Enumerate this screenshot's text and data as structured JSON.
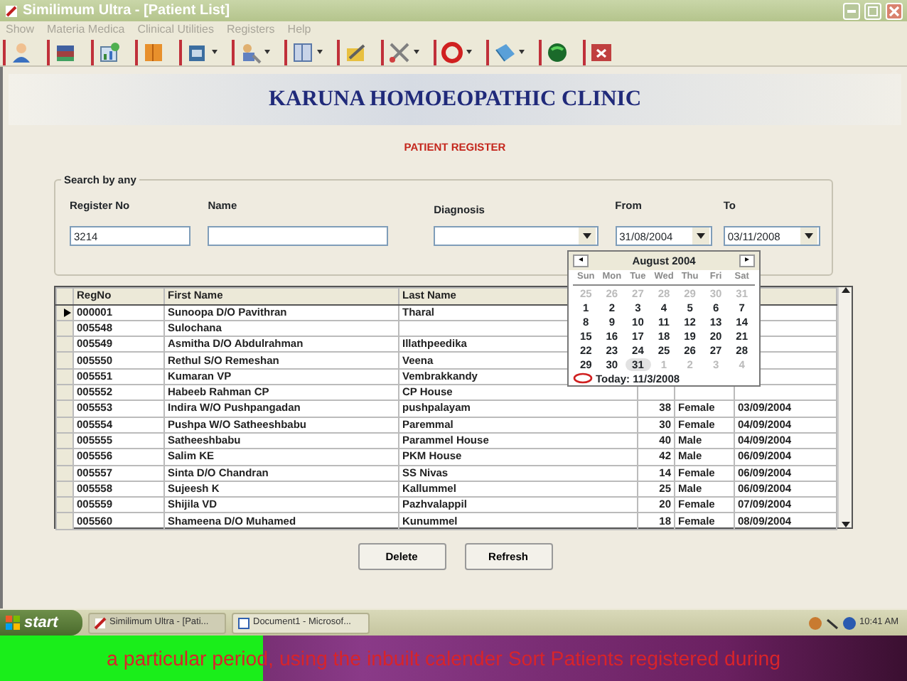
{
  "window": {
    "title": "Similimum Ultra - [Patient List]"
  },
  "menu": [
    "Show",
    "Materia Medica",
    "Clinical Utilities",
    "Registers",
    "Help"
  ],
  "toolbar": [
    {
      "kind": "person",
      "dropdown": false
    },
    {
      "kind": "books",
      "dropdown": false
    },
    {
      "kind": "chart",
      "dropdown": false
    },
    {
      "kind": "book",
      "dropdown": false
    },
    {
      "kind": "box",
      "dropdown": true
    },
    {
      "kind": "tools",
      "dropdown": true
    },
    {
      "kind": "notebook",
      "dropdown": true
    },
    {
      "kind": "pencil",
      "dropdown": false
    },
    {
      "kind": "scissors",
      "dropdown": true
    },
    {
      "kind": "ring",
      "dropdown": true
    },
    {
      "kind": "bookstack",
      "dropdown": true
    },
    {
      "kind": "globe",
      "dropdown": false
    },
    {
      "kind": "close",
      "dropdown": false
    }
  ],
  "clinic_name": "KARUNA HOMOEOPATHIC CLINIC",
  "page_title": "PATIENT REGISTER",
  "search": {
    "legend": "Search by any",
    "fields": [
      {
        "label": "Register No",
        "value": "3214",
        "kind": "text"
      },
      {
        "label": "Name",
        "kind": "text"
      },
      {
        "label": "Diagnosis",
        "kind": "combo"
      },
      {
        "label": "From",
        "value": "31/08/2004",
        "kind": "combo"
      },
      {
        "label": "To",
        "value": "03/11/2008",
        "kind": "combo"
      }
    ]
  },
  "table": {
    "columns": [
      "RegNo",
      "First Name",
      "Last Name"
    ],
    "rows": [
      {
        "selected": true,
        "cells": [
          "000001",
          "Sunoopa D/O Pavithran",
          "Tharal"
        ]
      },
      {
        "selected": false,
        "cells": [
          "005548",
          "Sulochana",
          ""
        ]
      },
      {
        "selected": false,
        "cells": [
          "005549",
          "Asmitha D/O Abdulrahman",
          "Illathpeedika"
        ]
      },
      {
        "selected": false,
        "cells": [
          "005550",
          "Rethul S/O Remeshan",
          "Veena"
        ]
      },
      {
        "selected": false,
        "cells": [
          "005551",
          "Kumaran VP",
          "Vembrakkandy"
        ]
      },
      {
        "selected": false,
        "cells": [
          "005552",
          "Habeeb Rahman CP",
          "CP House"
        ]
      },
      {
        "selected": false,
        "cells": [
          "005553",
          "Indira W/O Pushpangadan",
          "pushpalayam",
          "38",
          "Female",
          "03/09/2004"
        ]
      },
      {
        "selected": false,
        "cells": [
          "005554",
          "Pushpa W/O Satheeshbabu",
          "Paremmal",
          "30",
          "Female",
          "04/09/2004"
        ]
      },
      {
        "selected": false,
        "cells": [
          "005555",
          "Satheeshbabu",
          "Parammel House",
          "40",
          "Male",
          "04/09/2004"
        ]
      },
      {
        "selected": false,
        "cells": [
          "005556",
          "Salim KE",
          "PKM House",
          "42",
          "Male",
          "06/09/2004"
        ]
      },
      {
        "selected": false,
        "cells": [
          "005557",
          "Sinta D/O Chandran",
          "SS Nivas",
          "14",
          "Female",
          "06/09/2004"
        ]
      },
      {
        "selected": false,
        "cells": [
          "005558",
          "Sujeesh K",
          "Kallummel",
          "25",
          "Male",
          "06/09/2004"
        ]
      },
      {
        "selected": false,
        "cells": [
          "005559",
          "Shijila VD",
          "Pazhvalappil",
          "20",
          "Female",
          "07/09/2004"
        ]
      },
      {
        "selected": false,
        "cells": [
          "005560",
          "Shameena D/O Muhamed",
          "Kunummel",
          "18",
          "Female",
          "08/09/2004"
        ]
      }
    ]
  },
  "calendar": {
    "prev": "◂",
    "month": "August 2004",
    "next": "▸",
    "weekdays": [
      "Sun",
      "Mon",
      "Tue",
      "Wed",
      "Thu",
      "Fri",
      "Sat"
    ],
    "days": [
      {
        "text": "25",
        "muted": true,
        "selected": false
      },
      {
        "text": "26",
        "muted": true,
        "selected": false
      },
      {
        "text": "27",
        "muted": true,
        "selected": false
      },
      {
        "text": "28",
        "muted": true,
        "selected": false
      },
      {
        "text": "29",
        "muted": true,
        "selected": false
      },
      {
        "text": "30",
        "muted": true,
        "selected": false
      },
      {
        "text": "31",
        "muted": true,
        "selected": false
      },
      {
        "text": "1",
        "muted": false,
        "selected": false
      },
      {
        "text": "2",
        "muted": false,
        "selected": false
      },
      {
        "text": "3",
        "muted": false,
        "selected": false
      },
      {
        "text": "4",
        "muted": false,
        "selected": false
      },
      {
        "text": "5",
        "muted": false,
        "selected": false
      },
      {
        "text": "6",
        "muted": false,
        "selected": false
      },
      {
        "text": "7",
        "muted": false,
        "selected": false
      },
      {
        "text": "8",
        "muted": false,
        "selected": false
      },
      {
        "text": "9",
        "muted": false,
        "selected": false
      },
      {
        "text": "10",
        "muted": false,
        "selected": false
      },
      {
        "text": "11",
        "muted": false,
        "selected": false
      },
      {
        "text": "12",
        "muted": false,
        "selected": false
      },
      {
        "text": "13",
        "muted": false,
        "selected": false
      },
      {
        "text": "14",
        "muted": false,
        "selected": false
      },
      {
        "text": "15",
        "muted": false,
        "selected": false
      },
      {
        "text": "16",
        "muted": false,
        "selected": false
      },
      {
        "text": "17",
        "muted": false,
        "selected": false
      },
      {
        "text": "18",
        "muted": false,
        "selected": false
      },
      {
        "text": "19",
        "muted": false,
        "selected": false
      },
      {
        "text": "20",
        "muted": false,
        "selected": false
      },
      {
        "text": "21",
        "muted": false,
        "selected": false
      },
      {
        "text": "22",
        "muted": false,
        "selected": false
      },
      {
        "text": "23",
        "muted": false,
        "selected": false
      },
      {
        "text": "24",
        "muted": false,
        "selected": false
      },
      {
        "text": "25",
        "muted": false,
        "selected": false
      },
      {
        "text": "26",
        "muted": false,
        "selected": false
      },
      {
        "text": "27",
        "muted": false,
        "selected": false
      },
      {
        "text": "28",
        "muted": false,
        "selected": false
      },
      {
        "text": "29",
        "muted": false,
        "selected": false
      },
      {
        "text": "30",
        "muted": false,
        "selected": false
      },
      {
        "text": "31",
        "muted": false,
        "selected": true
      },
      {
        "text": "1",
        "muted": true,
        "selected": false
      },
      {
        "text": "2",
        "muted": true,
        "selected": false
      },
      {
        "text": "3",
        "muted": true,
        "selected": false
      },
      {
        "text": "4",
        "muted": true,
        "selected": false
      }
    ],
    "today": "Today: 11/3/2008"
  },
  "buttons": [
    "Delete",
    "Refresh"
  ],
  "taskbar": {
    "start": "start",
    "tasks": [
      "Similimum Ultra - [Pati...",
      "Document1 - Microsof..."
    ],
    "clock": "10:41 AM"
  },
  "caption": "a particular period, using the inbuilt calender Sort Patients registered during"
}
